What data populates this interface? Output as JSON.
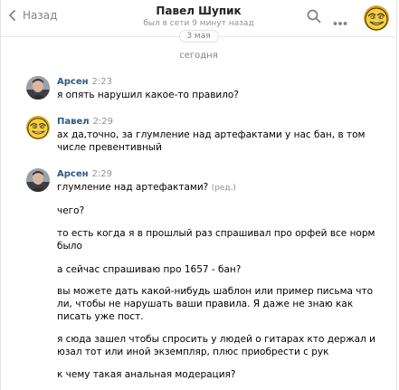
{
  "header": {
    "back_label": "Назад",
    "title": "Павел Шупик",
    "status": "был в сети 9 минут назад",
    "floating_date": "3 мая"
  },
  "date_separator": "сегодня",
  "messages": [
    {
      "author": "Арсен",
      "time": "2:23",
      "lines": [
        "я опять нарушил какое-то правило?"
      ]
    },
    {
      "author": "Павел",
      "time": "2:29",
      "lines": [
        "ах да,точно, за глумление над артефактами у нас бан, в том",
        "числе превентивный"
      ]
    },
    {
      "author": "Арсен",
      "time": "2:29",
      "lines": [
        "глумление над артефактами?"
      ],
      "edited_label": "(ред.)"
    }
  ],
  "continuation": [
    {
      "lines": [
        "чего?"
      ]
    },
    {
      "lines": [
        "то есть когда я в прошлый раз спрашивал про орфей все норм",
        "было"
      ]
    },
    {
      "lines": [
        "а сейчас спрашиваю про 1657 - бан?"
      ]
    },
    {
      "lines": [
        "вы можете дать какой-нибудь шаблон или пример письма что",
        "ли, чтобы не нарушать ваши правила. Я даже не знаю как",
        "писать уже пост."
      ]
    },
    {
      "lines": [
        "я сюда зашел чтобы спросить у людей о гитарах кто держал и",
        "юзал тот или иной экземпляр, плюс приобрести с рук"
      ]
    },
    {
      "lines": [
        "к чему такая анальная модерация?"
      ]
    }
  ],
  "colors": {
    "link": "#2a5885",
    "muted": "#939393",
    "icon": "#828282",
    "troll_face": "#f2c230"
  },
  "icons": [
    "back-chevron-icon",
    "search-icon",
    "more-icon",
    "troll-face-avatar",
    "user-photo-avatar"
  ]
}
